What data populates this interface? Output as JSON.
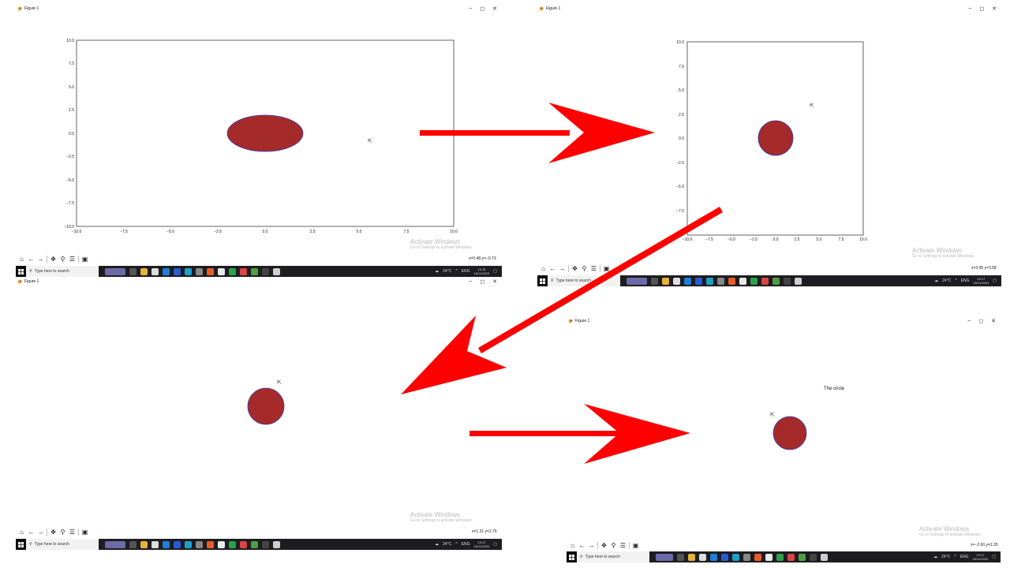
{
  "window_title": "Figure 1",
  "window_controls": {
    "minimize": "–",
    "maximize": "◻",
    "close": "✕"
  },
  "toolbar_icons": [
    "home-icon",
    "back-icon",
    "forward-icon",
    "pan-icon",
    "zoom-icon",
    "configure-icon",
    "save-icon"
  ],
  "panels": {
    "top_left": {
      "axes": {
        "xticks": [
          "−10.0",
          "−7.5",
          "−5.0",
          "−2.5",
          "0.0",
          "2.5",
          "5.0",
          "7.5",
          "10.0"
        ],
        "yticks": [
          "10.0",
          "7.5",
          "5.0",
          "2.5",
          "0.0",
          "−2.5",
          "−5.0",
          "−7.5",
          "−10.0"
        ]
      },
      "shape": {
        "type": "ellipse",
        "center": [
          0,
          0
        ],
        "width": 4,
        "height": 4
      },
      "coords": "x=5.48 y=−0.73",
      "clock": {
        "time": "19:15",
        "date": "16/11/2023"
      }
    },
    "top_right": {
      "axes": {
        "xticks": [
          "−10.0",
          "−7.5",
          "−5.0",
          "−2.5",
          "0.0",
          "2.5",
          "5.0",
          "7.5",
          "10.0"
        ],
        "yticks": [
          "10.0",
          "7.5",
          "5.0",
          "2.5",
          "0.0",
          "−2.5",
          "−5.0",
          "−7.5"
        ]
      },
      "shape": {
        "type": "circle",
        "center": [
          0,
          0
        ],
        "radius": 2
      },
      "coords": "x=3.95 y=3.58",
      "clock": {
        "time": "19:17",
        "date": "16/11/2023"
      }
    },
    "bottom_left": {
      "coords": "x=1.31 y=2.76",
      "clock": {
        "time": "19:17",
        "date": "16/11/2023"
      }
    },
    "bottom_right": {
      "title": "The circle",
      "coords": "x=−2.60 y=2.35",
      "clock": {
        "time": "19:17",
        "date": "16/11/2023"
      }
    }
  },
  "activate": {
    "line1": "Activate Windows",
    "line2": "Go to Settings to activate Windows."
  },
  "taskbar": {
    "search_placeholder": "Type here to search",
    "weather": "24°C",
    "lang": "ENG"
  },
  "colors": {
    "circle_fill": "#a52a2a",
    "circle_edge": "#3b3bb0",
    "arrow": "#ff0000",
    "taskbar": "#1d1d21"
  }
}
